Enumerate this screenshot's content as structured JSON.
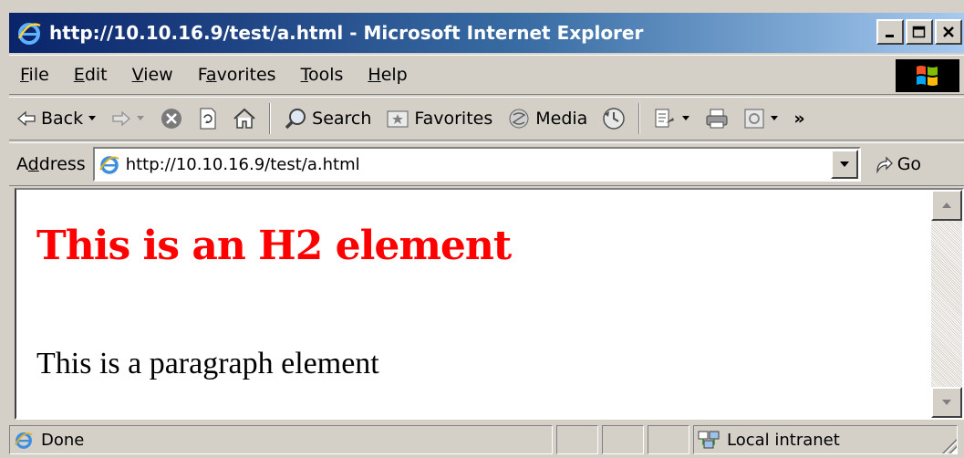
{
  "window": {
    "title": "http://10.10.16.9/test/a.html - Microsoft Internet Explorer",
    "buttons": {
      "minimize": "_",
      "maximize": "□",
      "close": "✕"
    }
  },
  "menu": {
    "items": [
      {
        "key": "F",
        "rest": "ile"
      },
      {
        "key": "E",
        "rest": "dit"
      },
      {
        "key": "V",
        "rest": "iew"
      },
      {
        "pre": "F",
        "key": "a",
        "rest": "vorites"
      },
      {
        "key": "T",
        "rest": "ools"
      },
      {
        "key": "H",
        "rest": "elp"
      }
    ]
  },
  "toolbar": {
    "back_label": "Back",
    "search_label": "Search",
    "favorites_label": "Favorites",
    "media_label": "Media",
    "more_label": "»"
  },
  "address": {
    "label_pre": "A",
    "label_key": "d",
    "label_rest": "dress",
    "url": "http://10.10.16.9/test/a.html",
    "go_label": "Go"
  },
  "content": {
    "h2": "This is an H2 element",
    "paragraph": "This is a paragraph element"
  },
  "status": {
    "text": "Done",
    "zone": "Local intranet"
  },
  "colors": {
    "titlebar_start": "#0a246a",
    "titlebar_end": "#a6caf0",
    "h2_color": "#ff0000",
    "chrome": "#d4d0c8"
  }
}
